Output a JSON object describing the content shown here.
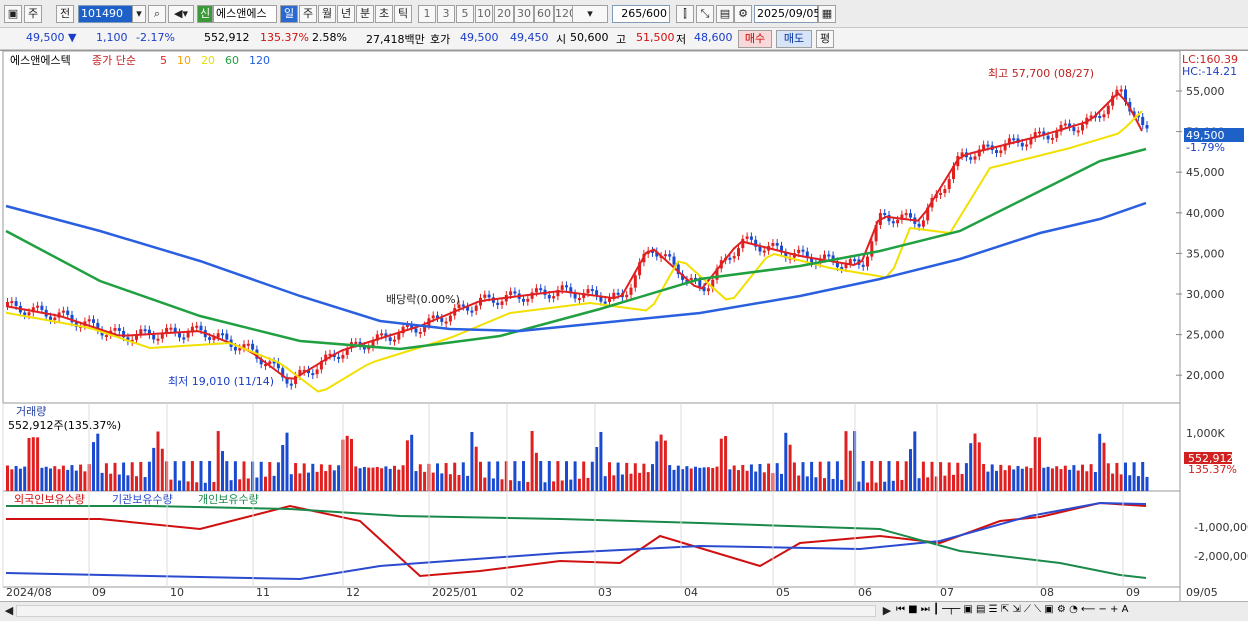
{
  "toolbar": {
    "market": "주",
    "prev": "전",
    "code": "101490",
    "new": "신",
    "name": "에스앤에스",
    "periods": [
      "일",
      "주",
      "월",
      "년",
      "분",
      "초",
      "틱"
    ],
    "nums": [
      "1",
      "3",
      "5",
      "10",
      "20",
      "30",
      "60",
      "120"
    ],
    "count": "265",
    "total": "/600",
    "date": "2025/09/05"
  },
  "quote": {
    "price": "49,500 ▼",
    "change": "1,100",
    "rate": "-2.17%",
    "volume": "552,912",
    "vol_rate": "135.37%",
    "turnover": "2.58%",
    "amount": "27,418백만",
    "hoga_label": "호가",
    "ask": "49,500",
    "bid": "49,450",
    "open_label": "시",
    "open": "50,600",
    "high_label": "고",
    "high": "51,500",
    "low_label": "저",
    "low": "48,600",
    "buy": "매수",
    "sell": "매도",
    "eval": "평"
  },
  "chart": {
    "stock_label": "에스앤에스텍",
    "legend_title": "종가 단순",
    "ma": [
      {
        "p": "5",
        "c": "#e02020"
      },
      {
        "p": "10",
        "c": "#f2a000"
      },
      {
        "p": "20",
        "c": "#e8e000"
      },
      {
        "p": "60",
        "c": "#20a040"
      },
      {
        "p": "120",
        "c": "#2060e0"
      }
    ],
    "lc": "LC:160.39",
    "hc": "HC:-14.21",
    "high_note": "최고 57,700 (08/27)",
    "low_note": "최저 19,010 (11/14)",
    "div_note": "배당락(0.00%)",
    "current_price": "49,500",
    "current_rate": "-1.79%",
    "price_ticks": [
      "55,000",
      "50,000",
      "45,000",
      "40,000",
      "35,000",
      "30,000",
      "25,000",
      "20,000"
    ],
    "vol_title": "거래량",
    "vol_info": "552,912주(135.37%)",
    "vol_tick": "1,000K",
    "vol_cur": "552,912",
    "vol_cur_rate": "135.37%",
    "hold_legend": [
      "외국인보유수량",
      "기관보유수량",
      "개인보유수량"
    ],
    "hold_ticks": [
      "-1,000,000",
      "-2,000,000"
    ],
    "x_labels": [
      "2024/08",
      "09",
      "10",
      "11",
      "12",
      "2025/01",
      "02",
      "03",
      "04",
      "05",
      "06",
      "07",
      "08",
      "09"
    ],
    "x_end": "09/05"
  }
}
